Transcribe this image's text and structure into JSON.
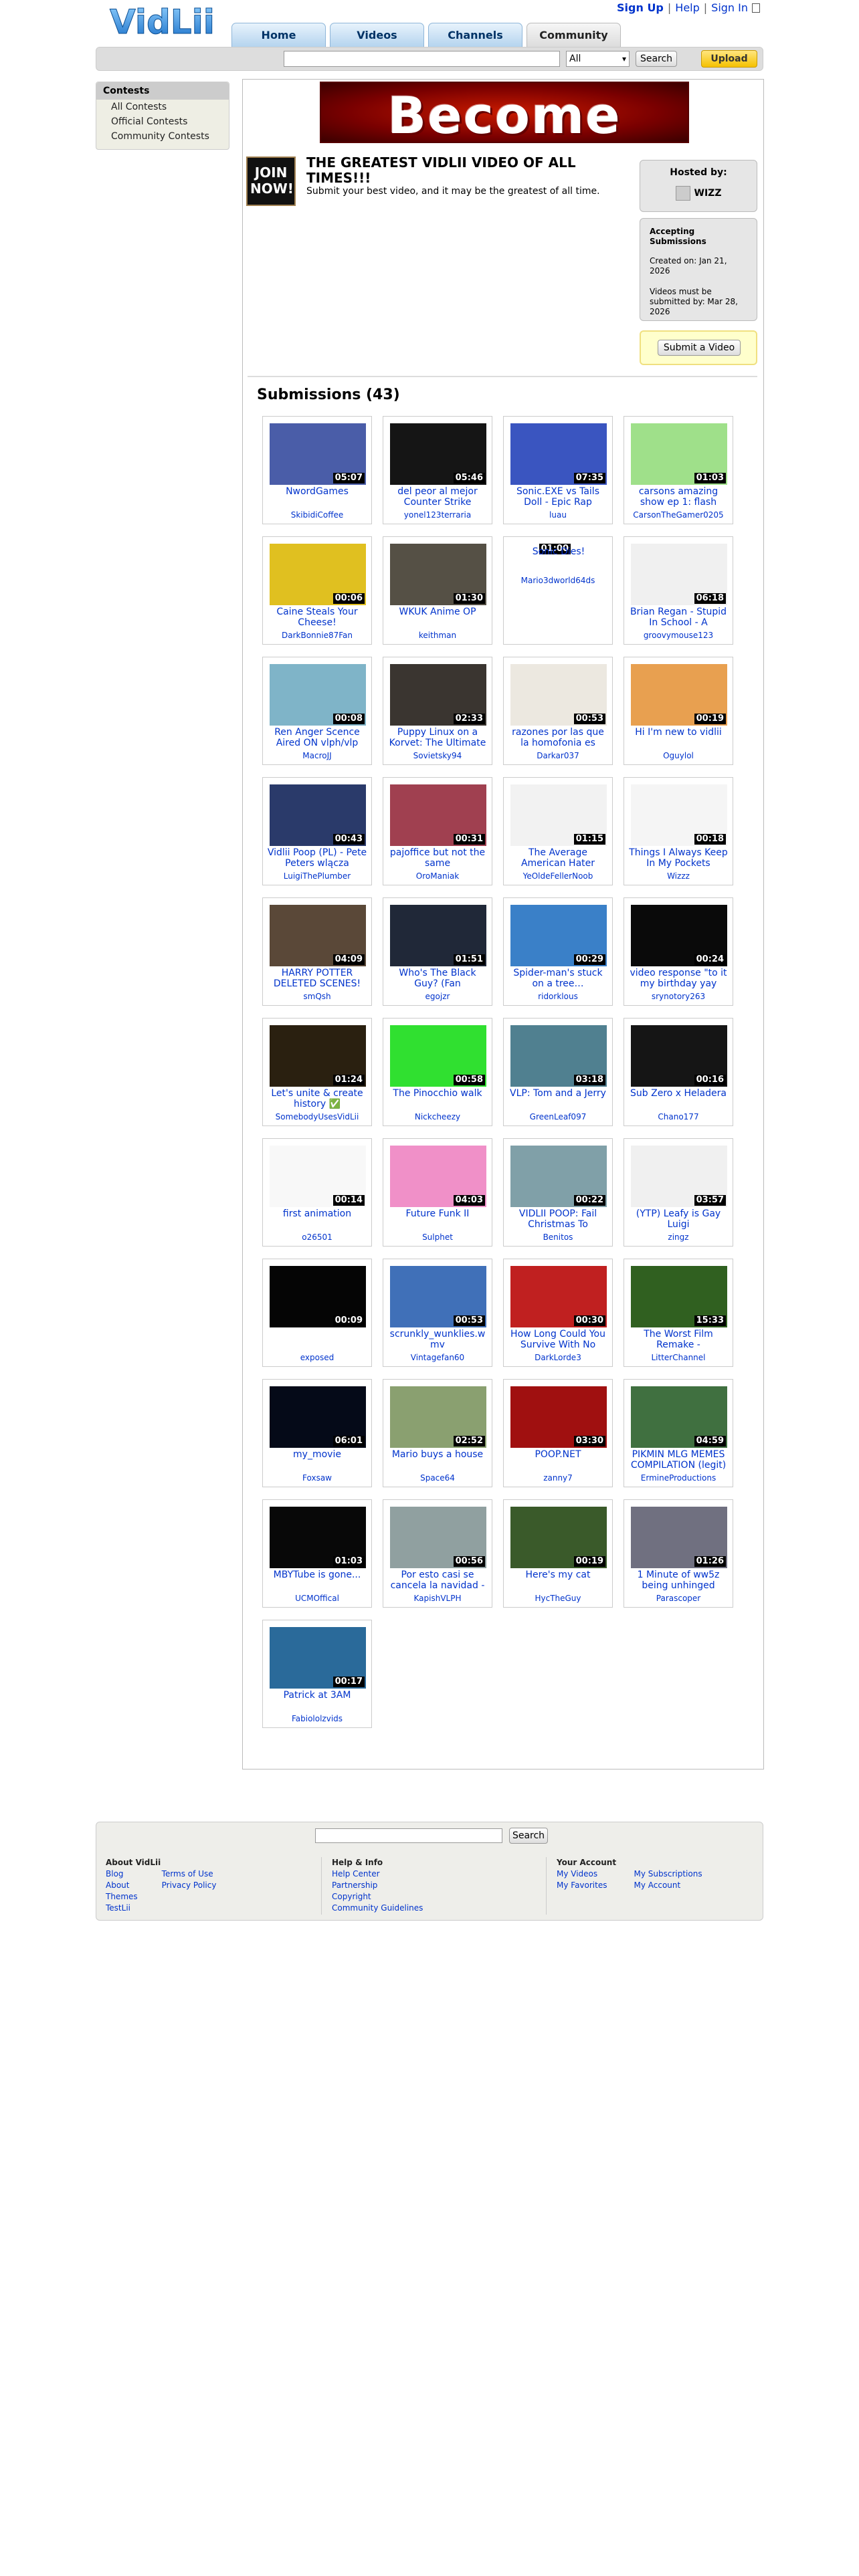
{
  "header": {
    "logo": "VidLii",
    "links": [
      "Sign Up",
      "Help",
      "Sign In"
    ],
    "tabs": [
      "Home",
      "Videos",
      "Channels",
      "Community"
    ],
    "active_tab": "Community",
    "search": {
      "placeholder": "",
      "category": "All",
      "button": "Search"
    },
    "upload": "Upload"
  },
  "sidebar": {
    "heading": "Contests",
    "items": [
      "All Contests",
      "Official Contests",
      "Community Contests"
    ]
  },
  "contest": {
    "banner_text": "Become",
    "icon_text": "JOIN NOW!",
    "title": "THE GREATEST VIDLII VIDEO OF ALL TIMES!!!",
    "description": "Submit your best video, and it may be the greatest of all time.",
    "hosted_by_label": "Hosted by:",
    "host": "WIZZ",
    "status": "Accepting Submissions",
    "created": "Created on: Jan 21, 2026",
    "deadline": "Videos must be submitted by: Mar 28, 2026",
    "submit_button": "Submit a Video"
  },
  "submissions": {
    "heading": "Submissions (43)",
    "items": [
      {
        "title": "NwordGames",
        "author": "SkibidiCoffee",
        "duration": "05:07",
        "thumb": "#4a5da8"
      },
      {
        "title": "del peor al mejor Counter Strike",
        "author": "yonel123terraria",
        "duration": "05:46",
        "thumb": "#151515"
      },
      {
        "title": "Sonic.EXE vs Tails Doll - Epic Rap",
        "author": "luau",
        "duration": "07:35",
        "thumb": "#3a55c0"
      },
      {
        "title": "carsons amazing show ep 1: flash",
        "author": "CarsonTheGamer0205",
        "duration": "01:03",
        "thumb": "#9fe08a"
      },
      {
        "title": "Caine Steals Your Cheese!",
        "author": "DarkBonnie87Fan",
        "duration": "00:06",
        "thumb": "#e0c020"
      },
      {
        "title": "WKUK Anime OP",
        "author": "keithman",
        "duration": "01:30",
        "thumb": "#555045"
      },
      {
        "title": "Sonic Dies!",
        "author": "Mario3dworld64ds",
        "duration": "01:00",
        "thumb": "#ffffff",
        "broken": true
      },
      {
        "title": "Brian Regan - Stupid In School - A",
        "author": "groovymouse123",
        "duration": "06:18",
        "thumb": "#f0f0f0"
      },
      {
        "title": "Ren Anger Scence Aired ON vlph/vlp",
        "author": "MacroJJ",
        "duration": "00:08",
        "thumb": "#7fb4c8"
      },
      {
        "title": "Puppy Linux on a Korvet: The Ultimate",
        "author": "Sovietsky94",
        "duration": "02:33",
        "thumb": "#3a3530"
      },
      {
        "title": "razones por las que la homofonia es",
        "author": "Darkar037",
        "duration": "00:53",
        "thumb": "#ece8e0"
      },
      {
        "title": "Hi I'm new to vidlii",
        "author": "Oguylol",
        "duration": "00:19",
        "thumb": "#e8a050"
      },
      {
        "title": "Vidlii Poop (PL) - Pete Peters wlącza",
        "author": "LuigiThePlumber",
        "duration": "00:43",
        "thumb": "#2a3a6a"
      },
      {
        "title": "pajoffice but not the same",
        "author": "OroManiak",
        "duration": "00:31",
        "thumb": "#a04050"
      },
      {
        "title": "The Average American Hater",
        "author": "YeOldeFellerNoob",
        "duration": "01:15",
        "thumb": "#f2f2f2"
      },
      {
        "title": "Things I Always Keep In My Pockets",
        "author": "Wizzz",
        "duration": "00:18",
        "thumb": "#f5f5f5"
      },
      {
        "title": "HARRY POTTER DELETED SCENES!",
        "author": "smQsh",
        "duration": "04:09",
        "thumb": "#5a4838"
      },
      {
        "title": "Who's The Black Guy? (Fan",
        "author": "egojzr",
        "duration": "01:51",
        "thumb": "#202838"
      },
      {
        "title": "Spider-man's stuck on a tree…",
        "author": "ridorklous",
        "duration": "00:29",
        "thumb": "#3a80c8"
      },
      {
        "title": "video response \"to it my birthday yay",
        "author": "srynotory263",
        "duration": "00:24",
        "thumb": "#0a0a0a"
      },
      {
        "title": "Let's unite & create history ✅",
        "author": "SomebodyUsesVidLii",
        "duration": "01:24",
        "thumb": "#2a2010"
      },
      {
        "title": "The Pinocchio walk",
        "author": "Nickcheezy",
        "duration": "00:58",
        "thumb": "#30e030"
      },
      {
        "title": "VLP: Tom and a Jerry",
        "author": "GreenLeaf097",
        "duration": "03:18",
        "thumb": "#508090"
      },
      {
        "title": "Sub Zero x Heladera",
        "author": "Chano177",
        "duration": "00:16",
        "thumb": "#151515"
      },
      {
        "title": "first animation",
        "author": "o26501",
        "duration": "00:14",
        "thumb": "#f8f8f8"
      },
      {
        "title": "Future Funk II",
        "author": "Sulphet",
        "duration": "04:03",
        "thumb": "#f090c8"
      },
      {
        "title": "VIDLII POOP: Fail Christmas To",
        "author": "Benitos",
        "duration": "00:22",
        "thumb": "#80a0a8"
      },
      {
        "title": "(YTP) Leafy is Gay Luigi",
        "author": "zingz",
        "duration": "03:57",
        "thumb": "#f0f0f0"
      },
      {
        "title": "",
        "author": "exposed",
        "duration": "00:09",
        "thumb": "#050505"
      },
      {
        "title": "scrunkly_wunklies.w mv",
        "author": "Vintagefan60",
        "duration": "00:53",
        "thumb": "#4070b8"
      },
      {
        "title": "How Long Could You Survive With No",
        "author": "DarkLorde3",
        "duration": "00:30",
        "thumb": "#c02020"
      },
      {
        "title": "The Worst Film Remake -",
        "author": "LitterChannel",
        "duration": "15:33",
        "thumb": "#306020"
      },
      {
        "title": "my_movie",
        "author": "Foxsaw",
        "duration": "06:01",
        "thumb": "#050a18"
      },
      {
        "title": "Mario buys a house",
        "author": "Space64",
        "duration": "02:52",
        "thumb": "#8aa070"
      },
      {
        "title": "POOP.NET",
        "author": "zanny7",
        "duration": "03:30",
        "thumb": "#a01010"
      },
      {
        "title": "PIKMIN MLG MEMES COMPILATION (legit)",
        "author": "ErmineProductions",
        "duration": "04:59",
        "thumb": "#407040"
      },
      {
        "title": "MBYTube is gone...",
        "author": "UCMOffical",
        "duration": "01:03",
        "thumb": "#080808"
      },
      {
        "title": "Por esto casi se cancela la navidad -",
        "author": "KapishVLPH",
        "duration": "00:56",
        "thumb": "#90a0a0"
      },
      {
        "title": "Here's my cat",
        "author": "HycTheGuy",
        "duration": "00:19",
        "thumb": "#3a5a2a"
      },
      {
        "title": "1 Minute of ww5z being unhinged",
        "author": "Parascoper",
        "duration": "01:26",
        "thumb": "#707080"
      },
      {
        "title": "Patrick at 3AM",
        "author": "Fabiololzvids",
        "duration": "00:17",
        "thumb": "#2a6a9a"
      }
    ]
  },
  "footer": {
    "search_button": "Search",
    "col1": {
      "heading": "About VidLii",
      "a": [
        "Blog",
        "About",
        "Themes",
        "TestLii"
      ],
      "b": [
        "Terms of Use",
        "Privacy Policy"
      ]
    },
    "col2": {
      "heading": "Help & Info",
      "items": [
        "Help Center",
        "Partnership",
        "Copyright",
        "Community Guidelines"
      ]
    },
    "col3": {
      "heading": "Your Account",
      "a": [
        "My Videos",
        "My Favorites"
      ],
      "b": [
        "My Subscriptions",
        "My Account"
      ]
    }
  }
}
